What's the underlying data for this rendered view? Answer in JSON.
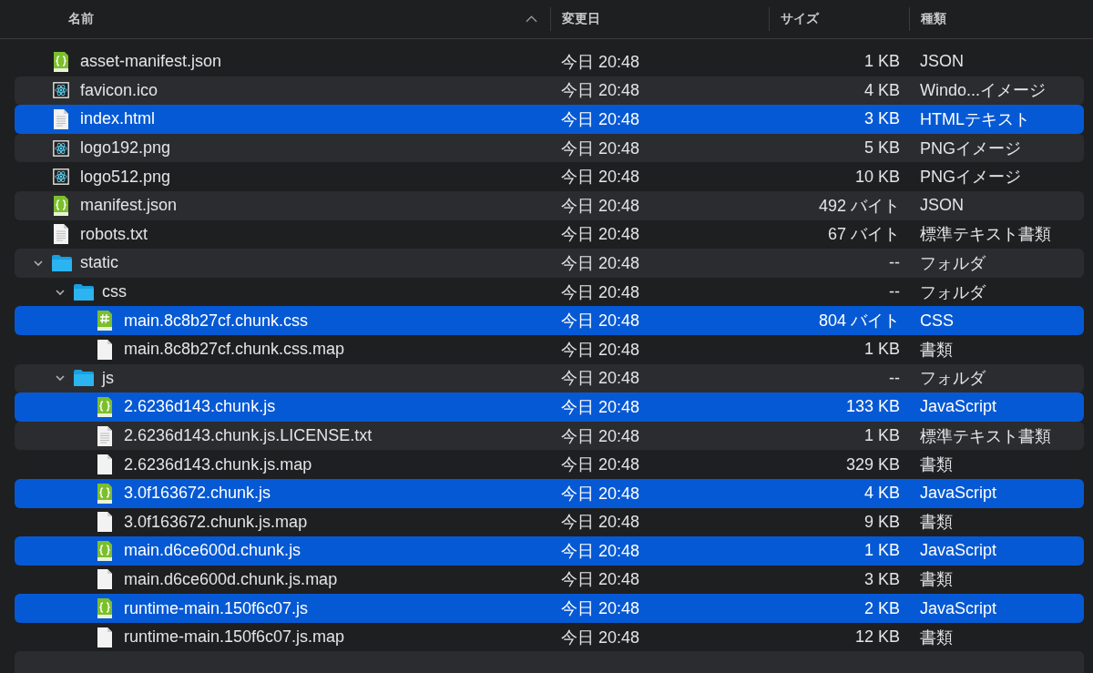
{
  "columns": [
    {
      "label": "名前",
      "sorted": true
    },
    {
      "label": "変更日",
      "sorted": false
    },
    {
      "label": "サイズ",
      "sorted": false
    },
    {
      "label": "種類",
      "sorted": false
    }
  ],
  "files": [
    {
      "name": "asset-manifest.json",
      "kind": "code",
      "date": "今日 20:48",
      "size": "1 KB",
      "type": "JSON",
      "selected": false
    },
    {
      "name": "favicon.ico",
      "kind": "react",
      "date": "今日 20:48",
      "size": "4 KB",
      "type": "Windo...イメージ",
      "selected": false
    },
    {
      "name": "index.html",
      "kind": "text",
      "date": "今日 20:48",
      "size": "3 KB",
      "type": "HTMLテキスト",
      "selected": true
    },
    {
      "name": "logo192.png",
      "kind": "react",
      "date": "今日 20:48",
      "size": "5 KB",
      "type": "PNGイメージ",
      "selected": false
    },
    {
      "name": "logo512.png",
      "kind": "react",
      "date": "今日 20:48",
      "size": "10 KB",
      "type": "PNGイメージ",
      "selected": false
    },
    {
      "name": "manifest.json",
      "kind": "code",
      "date": "今日 20:48",
      "size": "492 バイト",
      "type": "JSON",
      "selected": false
    },
    {
      "name": "robots.txt",
      "kind": "text",
      "date": "今日 20:48",
      "size": "67 バイト",
      "type": "標準テキスト書類",
      "selected": false
    },
    {
      "name": "static",
      "kind": "folder",
      "expanded": true,
      "date": "今日 20:48",
      "size": "--",
      "type": "フォルダ",
      "selected": false,
      "children": [
        {
          "name": "css",
          "kind": "folder",
          "expanded": true,
          "date": "今日 20:48",
          "size": "--",
          "type": "フォルダ",
          "selected": false,
          "children": [
            {
              "name": "main.8c8b27cf.chunk.css",
              "kind": "css",
              "date": "今日 20:48",
              "size": "804 バイト",
              "type": "CSS",
              "selected": true
            },
            {
              "name": "main.8c8b27cf.chunk.css.map",
              "kind": "blank",
              "date": "今日 20:48",
              "size": "1 KB",
              "type": "書類",
              "selected": false
            }
          ]
        },
        {
          "name": "js",
          "kind": "folder",
          "expanded": true,
          "date": "今日 20:48",
          "size": "--",
          "type": "フォルダ",
          "selected": false,
          "children": [
            {
              "name": "2.6236d143.chunk.js",
              "kind": "code",
              "date": "今日 20:48",
              "size": "133 KB",
              "type": "JavaScript",
              "selected": true
            },
            {
              "name": "2.6236d143.chunk.js.LICENSE.txt",
              "kind": "text",
              "date": "今日 20:48",
              "size": "1 KB",
              "type": "標準テキスト書類",
              "selected": false
            },
            {
              "name": "2.6236d143.chunk.js.map",
              "kind": "blank",
              "date": "今日 20:48",
              "size": "329 KB",
              "type": "書類",
              "selected": false
            },
            {
              "name": "3.0f163672.chunk.js",
              "kind": "code",
              "date": "今日 20:48",
              "size": "4 KB",
              "type": "JavaScript",
              "selected": true
            },
            {
              "name": "3.0f163672.chunk.js.map",
              "kind": "blank",
              "date": "今日 20:48",
              "size": "9 KB",
              "type": "書類",
              "selected": false
            },
            {
              "name": "main.d6ce600d.chunk.js",
              "kind": "code",
              "date": "今日 20:48",
              "size": "1 KB",
              "type": "JavaScript",
              "selected": true
            },
            {
              "name": "main.d6ce600d.chunk.js.map",
              "kind": "blank",
              "date": "今日 20:48",
              "size": "3 KB",
              "type": "書類",
              "selected": false
            },
            {
              "name": "runtime-main.150f6c07.js",
              "kind": "code",
              "date": "今日 20:48",
              "size": "2 KB",
              "type": "JavaScript",
              "selected": true
            },
            {
              "name": "runtime-main.150f6c07.js.map",
              "kind": "blank",
              "date": "今日 20:48",
              "size": "12 KB",
              "type": "書類",
              "selected": false
            }
          ]
        }
      ]
    }
  ]
}
